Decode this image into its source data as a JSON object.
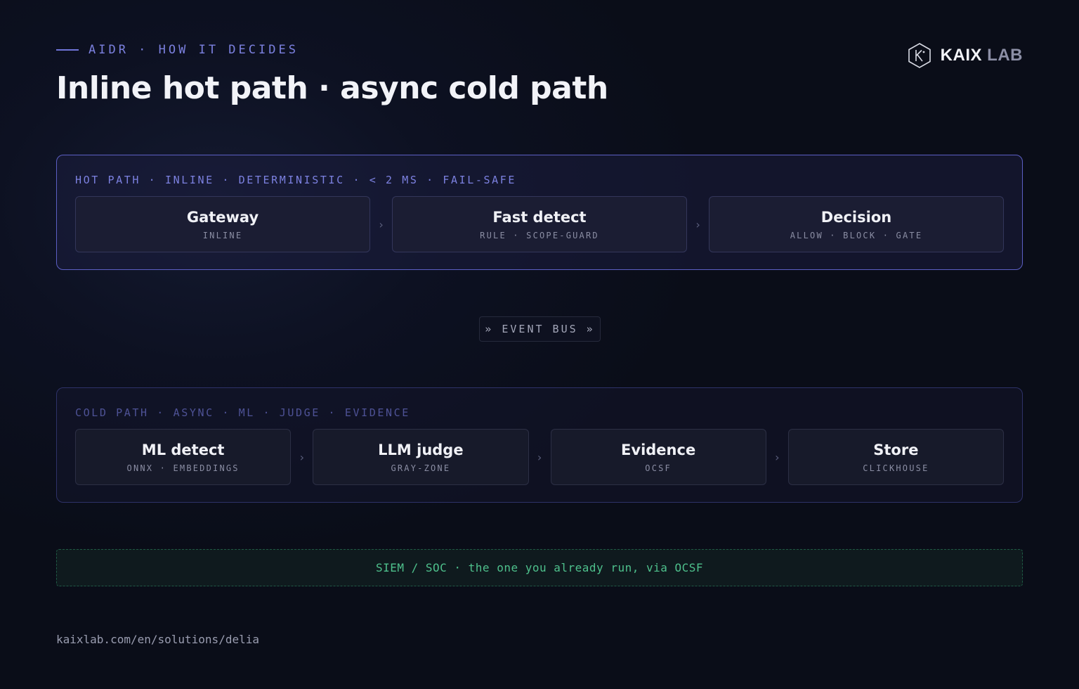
{
  "header": {
    "eyebrow": "AIDR · HOW IT DECIDES",
    "title": "Inline hot path · async cold path"
  },
  "brand": {
    "name_primary": "KAIX",
    "name_secondary": "LAB",
    "logo_icon": "hexagon-k-icon"
  },
  "hot_path": {
    "label": "HOT PATH · INLINE · DETERMINISTIC · < 2 MS · FAIL-SAFE",
    "separator": "›",
    "nodes": [
      {
        "title": "Gateway",
        "subtitle": "INLINE"
      },
      {
        "title": "Fast detect",
        "subtitle": "RULE · SCOPE-GUARD"
      },
      {
        "title": "Decision",
        "subtitle": "ALLOW · BLOCK · GATE"
      }
    ]
  },
  "event_bus": {
    "label": "» EVENT BUS »"
  },
  "cold_path": {
    "label": "COLD PATH · ASYNC · ML · JUDGE · EVIDENCE",
    "separator": "›",
    "nodes": [
      {
        "title": "ML detect",
        "subtitle": "ONNX · EMBEDDINGS"
      },
      {
        "title": "LLM judge",
        "subtitle": "GRAY-ZONE"
      },
      {
        "title": "Evidence",
        "subtitle": "OCSF"
      },
      {
        "title": "Store",
        "subtitle": "CLICKHOUSE"
      }
    ]
  },
  "siem": {
    "label": "SIEM / SOC · the one you already run, via OCSF"
  },
  "footer": {
    "url": "kaixlab.com/en/solutions/delia"
  },
  "colors": {
    "accent": "#7c81e0",
    "hot_border": "#5c5fc4",
    "cold_border": "#2e3268",
    "siem_green": "#4ec08c"
  }
}
